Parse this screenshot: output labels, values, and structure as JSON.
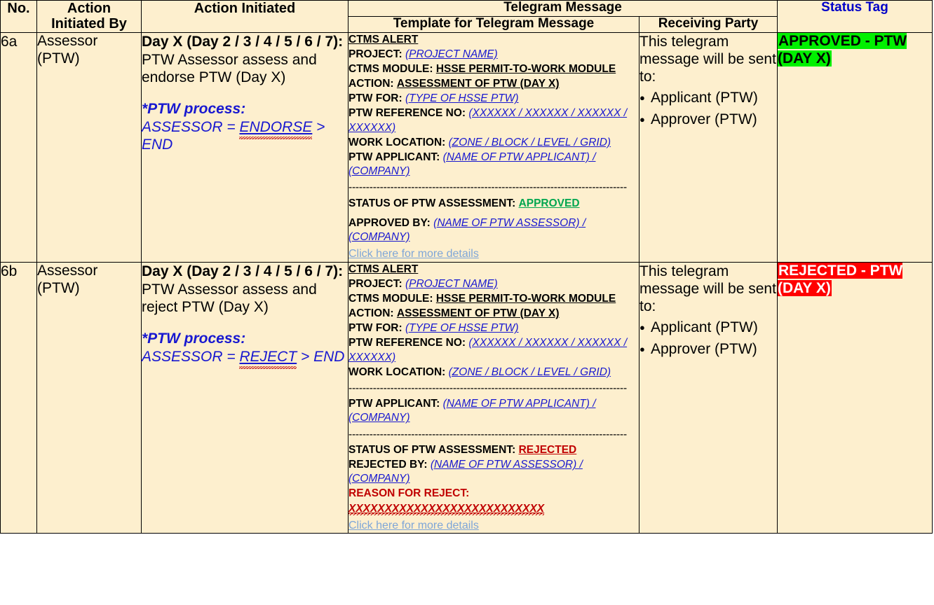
{
  "table": {
    "headers": {
      "no": "No.",
      "initiated_by": "Action\nInitiated By",
      "initiated_by_l1": "Action",
      "initiated_by_l2": "Initiated By",
      "action_initiated": "Action Initiated",
      "telegram_message": "Telegram Message",
      "template": "Template for Telegram Message",
      "receiving_party": "Receiving Party",
      "status_tag": "Status Tag"
    },
    "colors": {
      "header_plain_bg": "#D9DEEE",
      "header_telegram_bg": "#00AEEF",
      "header_sub_bg": "#BFE9FB",
      "header_status_bg": "#FFC000",
      "header_status_text": "#0000C8",
      "cell_bg": "#FDEFCE",
      "variable_blue": "#1818D0",
      "approved_green": "#00A64F",
      "rejected_red": "#C00000",
      "link_blue": "#7EA6D8",
      "tag_approved_bg": "#00F000",
      "tag_rejected_bg": "#FF0000"
    },
    "rows": [
      {
        "no": "6a",
        "initiated_by": "Assessor (PTW)",
        "action": {
          "day": "Day X (Day 2 / 3 / 4 / 5 / 6 / 7):",
          "description": "PTW Assessor assess and endorse PTW (Day X)",
          "process_label": "*PTW process:",
          "process_flow_prefix": "ASSESSOR = ",
          "process_flow_action": "ENDORSE",
          "process_flow_suffix": " > END"
        },
        "template": {
          "title": "CTMS ALERT",
          "project_label": "PROJECT:",
          "project_value": "(PROJECT NAME)",
          "module_label": "CTMS MODULE:",
          "module_value": "HSSE PERMIT-TO-WORK MODULE",
          "action_label": "ACTION:",
          "action_value": "ASSESSMENT OF PTW (DAY X)",
          "ptw_for_label": "PTW FOR:",
          "ptw_for_value": "(TYPE OF HSSE PTW)",
          "ref_label": "PTW REFERENCE NO:",
          "ref_value": "(XXXXXX / XXXXXX / XXXXXX / XXXXXX)",
          "location_label": "WORK LOCATION:",
          "location_value": "(ZONE / BLOCK / LEVEL / GRID)",
          "applicant_label": "PTW APPLICANT:",
          "applicant_value": "(NAME OF PTW APPLICANT) / (COMPANY)",
          "divider": "--------------------------------------------------------------------------------",
          "status_label": "STATUS OF PTW ASSESSMENT:",
          "status_value": "APPROVED",
          "by_label": "APPROVED BY:",
          "by_value": "(NAME OF PTW ASSESSOR) / (COMPANY)",
          "link": "Click here for more details"
        },
        "receiving": {
          "intro": "This telegram message will be sent to:",
          "parties": [
            "Applicant (PTW)",
            "Approver (PTW)"
          ]
        },
        "status_tag": "APPROVED - PTW (DAY X)",
        "status_tag_kind": "approved"
      },
      {
        "no": "6b",
        "initiated_by": "Assessor (PTW)",
        "action": {
          "day": "Day X (Day 2 / 3 / 4 / 5 / 6 / 7):",
          "description": "PTW Assessor assess and reject PTW (Day X)",
          "process_label": "*PTW process:",
          "process_flow_prefix": "ASSESSOR = ",
          "process_flow_action": "REJECT",
          "process_flow_suffix": " > END"
        },
        "template": {
          "title": "CTMS ALERT",
          "project_label": "PROJECT:",
          "project_value": "(PROJECT NAME)",
          "module_label": "CTMS MODULE:",
          "module_value": "HSSE PERMIT-TO-WORK MODULE",
          "action_label": "ACTION:",
          "action_value": "ASSESSMENT OF PTW (DAY X)",
          "ptw_for_label": "PTW FOR:",
          "ptw_for_value": "(TYPE OF HSSE PTW)",
          "ref_label": "PTW REFERENCE NO:",
          "ref_value": "(XXXXXX / XXXXXX / XXXXXX / XXXXXX)",
          "location_label": "WORK LOCATION:",
          "location_value": "(ZONE / BLOCK / LEVEL / GRID)",
          "applicant_label": "PTW APPLICANT:",
          "applicant_value": "(NAME OF PTW APPLICANT) / (COMPANY)",
          "divider": "--------------------------------------------------------------------------------",
          "status_label": "STATUS OF PTW ASSESSMENT:",
          "status_value": "REJECTED",
          "by_label": "REJECTED BY:",
          "by_value": "(NAME OF PTW ASSESSOR) / (COMPANY)",
          "reason_label": "REASON FOR REJECT:",
          "reason_value": "XXXXXXXXXXXXXXXXXXXXXXXXXXX",
          "link": "Click here for more details"
        },
        "receiving": {
          "intro": "This telegram message will be sent to:",
          "parties": [
            "Applicant (PTW)",
            "Approver (PTW)"
          ]
        },
        "status_tag": "REJECTED - PTW (DAY X)",
        "status_tag_kind": "rejected"
      }
    ]
  }
}
